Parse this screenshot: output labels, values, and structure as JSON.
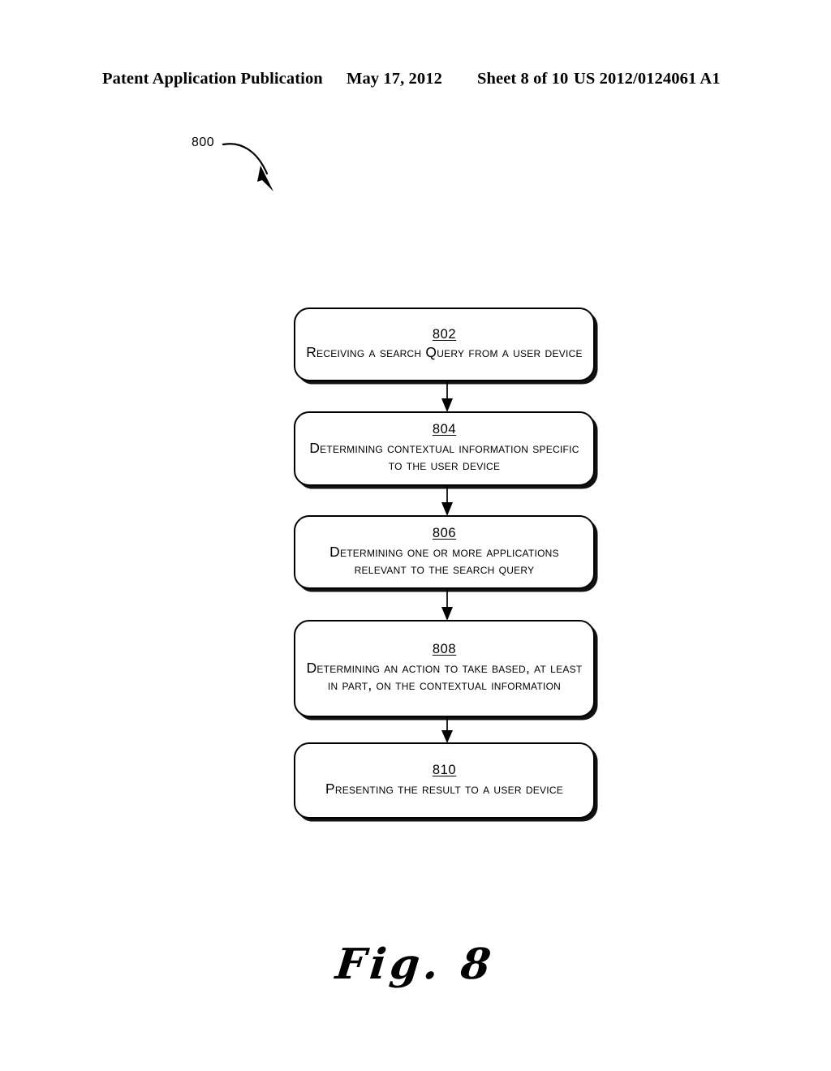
{
  "header": {
    "publication": "Patent Application Publication",
    "date": "May 17, 2012",
    "sheet": "Sheet 8 of 10",
    "patent_number": "US 2012/0124061 A1"
  },
  "figure": {
    "reference_label": "800",
    "caption": "Fig. 8",
    "arrow_icon": "curved-arrow-icon"
  },
  "flowchart": {
    "connector_icon": "down-arrow-icon",
    "steps": [
      {
        "id": "802",
        "text": "Receiving a search Query from a user device"
      },
      {
        "id": "804",
        "text": "Determining contextual information specific to the user device"
      },
      {
        "id": "806",
        "text": "Determining one or more applications relevant to the search query"
      },
      {
        "id": "808",
        "text": "Determining an action to take based, at least in part, on the contextual information"
      },
      {
        "id": "810",
        "text": "Presenting the result to a user device"
      }
    ]
  }
}
